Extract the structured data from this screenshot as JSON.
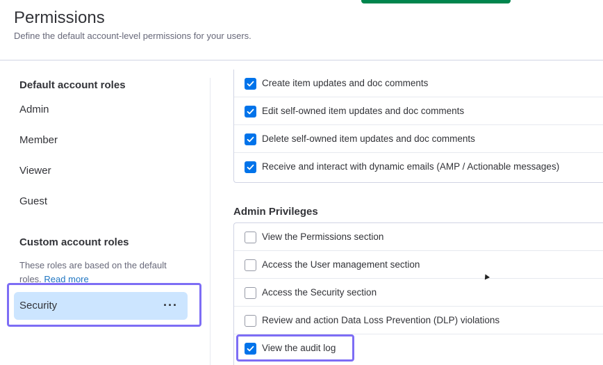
{
  "header": {
    "title": "Permissions",
    "subtitle": "Define the default account-level permissions for your users."
  },
  "sidebar": {
    "default_heading": "Default account roles",
    "default_roles": [
      "Admin",
      "Member",
      "Viewer",
      "Guest"
    ],
    "custom_heading": "Custom account roles",
    "custom_desc": "These roles are based on the default roles.",
    "read_more": "Read more",
    "custom_roles": [
      {
        "label": "Security",
        "menu": "···",
        "selected": true
      }
    ]
  },
  "permissions": {
    "general": [
      {
        "label": "Create item updates and doc comments",
        "checked": true
      },
      {
        "label": "Edit self-owned item updates and doc comments",
        "checked": true
      },
      {
        "label": "Delete self-owned item updates and doc comments",
        "checked": true
      },
      {
        "label": "Receive and interact with dynamic emails (AMP / Actionable messages)",
        "checked": true
      }
    ],
    "admin_heading": "Admin Privileges",
    "admin": [
      {
        "label": "View the Permissions section",
        "checked": false
      },
      {
        "label": "Access the User management section",
        "checked": false
      },
      {
        "label": "Access the Security section",
        "checked": false
      },
      {
        "label": "Review and action Data Loss Prevention (DLP) violations",
        "checked": false
      },
      {
        "label": "View the audit log",
        "checked": true
      }
    ]
  },
  "colors": {
    "accent": "#0073ea",
    "highlight_border": "#7d6df5",
    "selected_bg": "#cce5ff",
    "link": "#1f76c2"
  }
}
